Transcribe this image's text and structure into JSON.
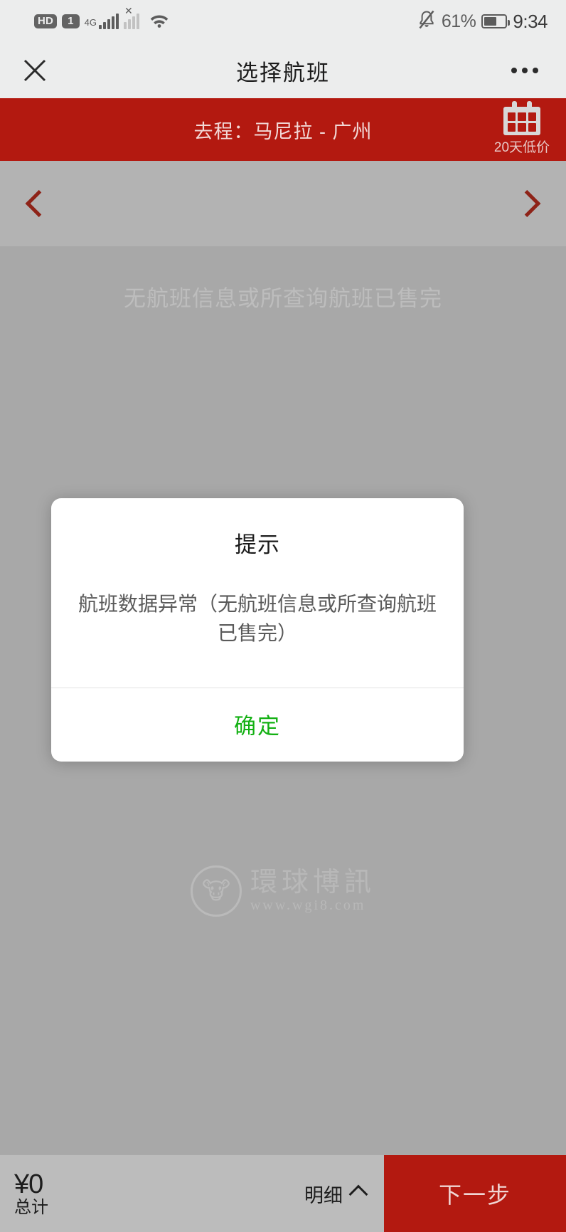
{
  "status_bar": {
    "hd_badge": "HD",
    "sim_badge": "1",
    "network_type": "4G",
    "signal_icon": "signal-bars-icon",
    "signal_off_icon": "signal-bars-disabled-icon",
    "wifi_icon": "wifi-icon",
    "mute_icon": "bell-muted-icon",
    "battery_percent": "61%",
    "battery_icon": "battery-icon",
    "clock": "9:34"
  },
  "nav_bar": {
    "close_icon": "close-icon",
    "title": "选择航班",
    "more_icon": "more-options-icon"
  },
  "route_bar": {
    "text": "去程：马尼拉 - 广州",
    "calendar_icon": "calendar-icon",
    "low_fare_label": "20天低价",
    "background_color": "#b31910"
  },
  "date_strip": {
    "prev_icon": "chevron-left-icon",
    "next_icon": "chevron-right-icon",
    "current_date": ""
  },
  "content": {
    "empty_message": "无航班信息或所查询航班已售完"
  },
  "watermark": {
    "logo_icon": "lion-logo-icon",
    "brand": "環球博訊",
    "url": "www.wgi8.com"
  },
  "dialog": {
    "title": "提示",
    "message": "航班数据异常（无航班信息或所查询航班已售完）",
    "confirm_label": "确定",
    "confirm_color": "#12b012"
  },
  "bottom_bar": {
    "total_amount": "¥0",
    "total_label": "总计",
    "detail_label": "明细",
    "detail_caret_icon": "chevron-up-icon",
    "next_label": "下一步",
    "next_color": "#b31910"
  }
}
